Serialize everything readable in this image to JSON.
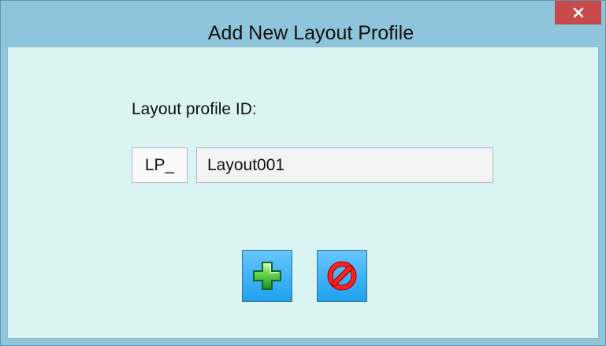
{
  "window": {
    "title": "Add New Layout Profile",
    "close_icon": "close-icon",
    "accent_color": "#8ec5da",
    "close_color": "#c94a4a",
    "content_background": "#daf4f3"
  },
  "form": {
    "profile_label": "Layout profile ID:",
    "prefix": "LP_",
    "profile_id_value": "Layout001"
  },
  "actions": {
    "add_icon": "green-plus-icon",
    "cancel_icon": "red-prohibited-icon",
    "button_color": "#1ea1ee"
  }
}
